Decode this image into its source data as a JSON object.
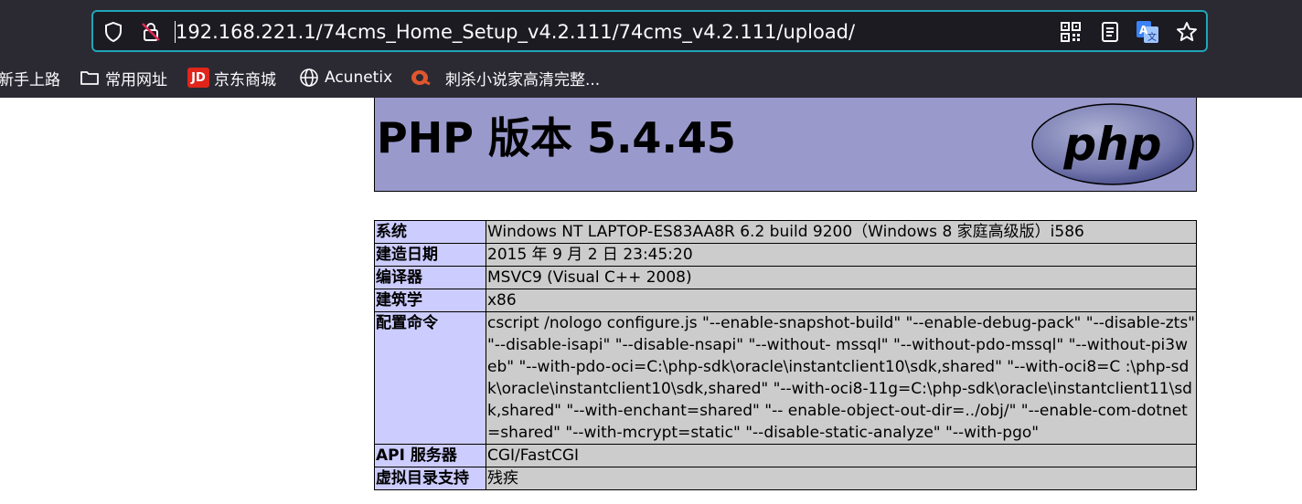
{
  "browser": {
    "url": "192.168.221.1/74cms_Home_Setup_v4.2.111/74cms_v4.2.111/upload/",
    "bookmarks": [
      {
        "label": "新手上路",
        "icon": "none"
      },
      {
        "label": "常用网址",
        "icon": "folder-icon"
      },
      {
        "label": "京东商城",
        "icon": "jd-logo-icon",
        "badge": "JD"
      },
      {
        "label": "Acunetix",
        "icon": "globe-icon"
      },
      {
        "label": "刺杀小说家高清完整...",
        "icon": "site-favicon-icon"
      }
    ],
    "accent_color": "#1fa5b8"
  },
  "phpinfo": {
    "title": "PHP 版本 5.4.45",
    "logo_text": "php",
    "header_color": "#9999cc",
    "rows": [
      {
        "key": "系统",
        "value": "Windows NT LAPTOP-ES83AA8R 6.2 build 9200（Windows 8 家庭高级版）i586"
      },
      {
        "key": "建造日期",
        "value": "2015 年 9 月 2 日 23:45:20"
      },
      {
        "key": "编译器",
        "value": "MSVC9 (Visual C++ 2008)"
      },
      {
        "key": "建筑学",
        "value": "x86"
      },
      {
        "key": "配置命令",
        "value": "cscript /nologo configure.js \"--enable-snapshot-build\" \"--enable-debug-pack\" \"--disable-zts\" \"--disable-isapi\" \"--disable-nsapi\" \"--without- mssql\" \"--without-pdo-mssql\" \"--without-pi3web\" \"--with-pdo-oci=C:\\php-sdk\\oracle\\instantclient10\\sdk,shared\" \"--with-oci8=C :\\php-sdk\\oracle\\instantclient10\\sdk,shared\" \"--with-oci8-11g=C:\\php-sdk\\oracle\\instantclient11\\sdk,shared\" \"--with-enchant=shared\" \"-- enable-object-out-dir=../obj/\" \"--enable-com-dotnet=shared\" \"--with-mcrypt=static\" \"--disable-static-analyze\" \"--with-pgo\""
      },
      {
        "key": "API 服务器",
        "value": "CGI/FastCGI"
      },
      {
        "key": "虚拟目录支持",
        "value": "残疾"
      }
    ]
  }
}
